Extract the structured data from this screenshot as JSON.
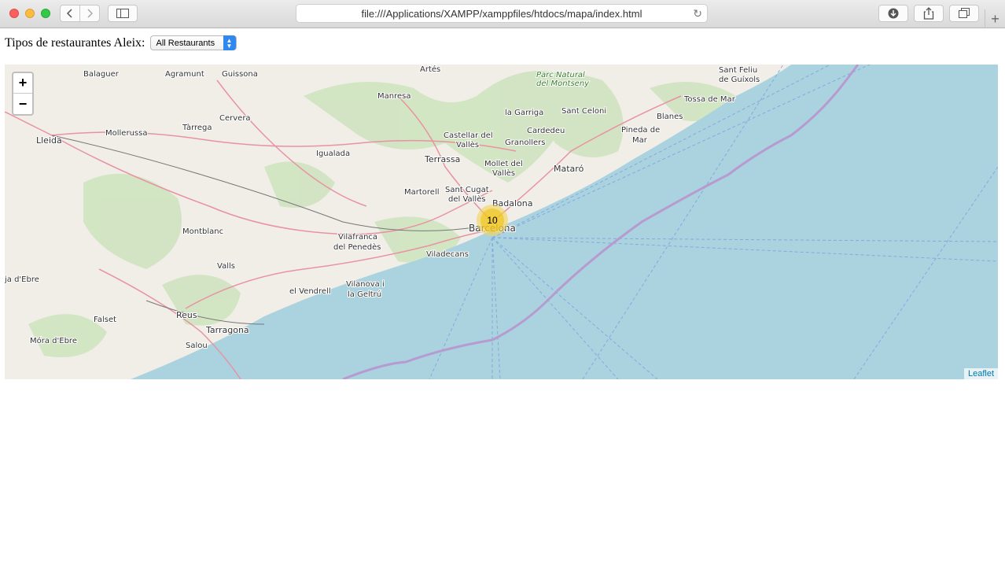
{
  "browser": {
    "url": "file:///Applications/XAMPP/xamppfiles/htdocs/mapa/index.html",
    "reload_icon": "reload-icon"
  },
  "filter": {
    "label": "Tipos de restaurantes Aleix:",
    "selected": "All Restaurants"
  },
  "map": {
    "zoom_in": "+",
    "zoom_out": "−",
    "cluster_count": "10",
    "attribution": "Leaflet",
    "places": {
      "artes": "Artés",
      "parc": "Parc Natural",
      "parc2": "del Montseny",
      "sant_feliu": "Sant Feliu",
      "sant_feliu2": "de Guíxols",
      "balaguer": "Balaguer",
      "agramunt": "Agramunt",
      "guissona": "Guissona",
      "manresa": "Manresa",
      "garriga": "la Garriga",
      "sant_celoni": "Sant Celoni",
      "tossa": "Tossa de Mar",
      "blanes": "Blanes",
      "cervera": "Cervera",
      "mollerussa": "Mollerussa",
      "tarrega": "Tàrrega",
      "lleida": "Lleida",
      "cardedeu": "Cardedeu",
      "pineda": "Pineda de",
      "pineda2": "Mar",
      "castellar": "Castellar del",
      "castellar2": "Vallès",
      "granollers": "Granollers",
      "igualada": "Igualada",
      "terrassa": "Terrassa",
      "mollet": "Mollet del",
      "mollet2": "Vallès",
      "mataro": "Mataró",
      "martorell": "Martorell",
      "sant_cugat": "Sant Cugat",
      "sant_cugat2": "del Vallès",
      "badalona": "Badalona",
      "barcelona": "Barcelona",
      "montblanc": "Montblanc",
      "vilafranca": "Vilafranca",
      "vilafranca2": "del Penedès",
      "viladecans": "Viladecans",
      "valls": "Valls",
      "ebre": "ja d'Ebre",
      "vilanova": "Vilanova i",
      "vilanova2": "la Geltrú",
      "vendrell": "el Vendrell",
      "reus": "Reus",
      "falset": "Falset",
      "tarragona": "Tarragona",
      "mora": "Móra d'Ebre",
      "salou": "Salou"
    }
  }
}
